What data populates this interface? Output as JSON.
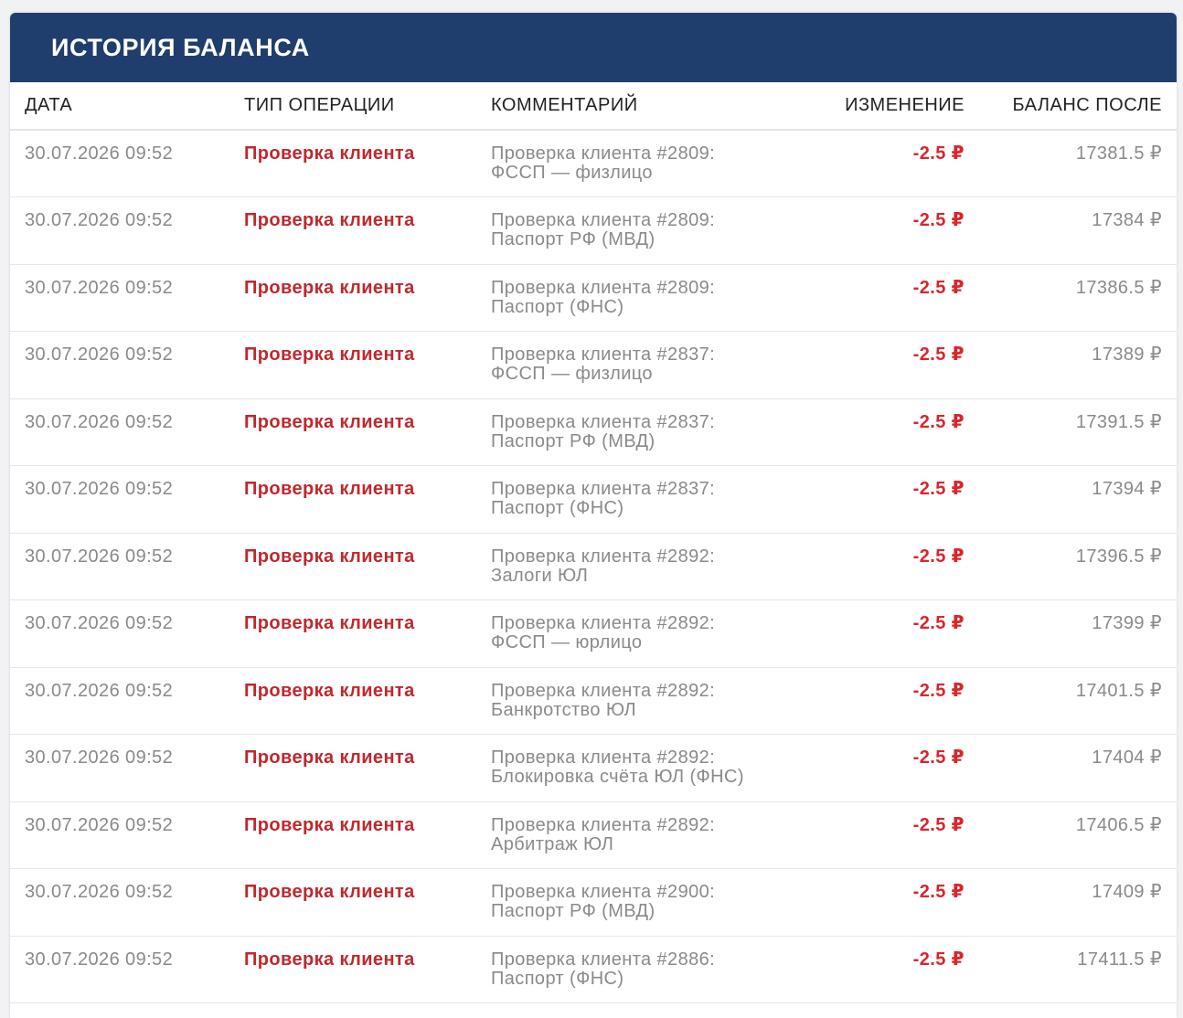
{
  "header": {
    "title": "ИСТОРИЯ БАЛАНСА"
  },
  "columns": {
    "date": "ДАТА",
    "type": "ТИП ОПЕРАЦИИ",
    "comment": "КОММЕНТАРИЙ",
    "change": "ИЗМЕНЕНИЕ",
    "balance": "БАЛАНС ПОСЛЕ"
  },
  "rows": [
    {
      "date": "30.07.2026 09:52",
      "type": "Проверка клиента",
      "comment1": "Проверка клиента #2809:",
      "comment2": "ФССП — физлицо",
      "change": "-2.5 ₽",
      "balance": "17381.5 ₽"
    },
    {
      "date": "30.07.2026 09:52",
      "type": "Проверка клиента",
      "comment1": "Проверка клиента #2809:",
      "comment2": "Паспорт РФ (МВД)",
      "change": "-2.5 ₽",
      "balance": "17384 ₽"
    },
    {
      "date": "30.07.2026 09:52",
      "type": "Проверка клиента",
      "comment1": "Проверка клиента #2809:",
      "comment2": "Паспорт (ФНС)",
      "change": "-2.5 ₽",
      "balance": "17386.5 ₽"
    },
    {
      "date": "30.07.2026 09:52",
      "type": "Проверка клиента",
      "comment1": "Проверка клиента #2837:",
      "comment2": "ФССП — физлицо",
      "change": "-2.5 ₽",
      "balance": "17389 ₽"
    },
    {
      "date": "30.07.2026 09:52",
      "type": "Проверка клиента",
      "comment1": "Проверка клиента #2837:",
      "comment2": "Паспорт РФ (МВД)",
      "change": "-2.5 ₽",
      "balance": "17391.5 ₽"
    },
    {
      "date": "30.07.2026 09:52",
      "type": "Проверка клиента",
      "comment1": "Проверка клиента #2837:",
      "comment2": "Паспорт (ФНС)",
      "change": "-2.5 ₽",
      "balance": "17394 ₽"
    },
    {
      "date": "30.07.2026 09:52",
      "type": "Проверка клиента",
      "comment1": "Проверка клиента #2892:",
      "comment2": "Залоги ЮЛ",
      "change": "-2.5 ₽",
      "balance": "17396.5 ₽"
    },
    {
      "date": "30.07.2026 09:52",
      "type": "Проверка клиента",
      "comment1": "Проверка клиента #2892:",
      "comment2": "ФССП — юрлицо",
      "change": "-2.5 ₽",
      "balance": "17399 ₽"
    },
    {
      "date": "30.07.2026 09:52",
      "type": "Проверка клиента",
      "comment1": "Проверка клиента #2892:",
      "comment2": "Банкротство ЮЛ",
      "change": "-2.5 ₽",
      "balance": "17401.5 ₽"
    },
    {
      "date": "30.07.2026 09:52",
      "type": "Проверка клиента",
      "comment1": "Проверка клиента #2892:",
      "comment2": "Блокировка счёта ЮЛ (ФНС)",
      "change": "-2.5 ₽",
      "balance": "17404 ₽"
    },
    {
      "date": "30.07.2026 09:52",
      "type": "Проверка клиента",
      "comment1": "Проверка клиента #2892:",
      "comment2": "Арбитраж ЮЛ",
      "change": "-2.5 ₽",
      "balance": "17406.5 ₽"
    },
    {
      "date": "30.07.2026 09:52",
      "type": "Проверка клиента",
      "comment1": "Проверка клиента #2900:",
      "comment2": "Паспорт РФ (МВД)",
      "change": "-2.5 ₽",
      "balance": "17409 ₽"
    },
    {
      "date": "30.07.2026 09:52",
      "type": "Проверка клиента",
      "comment1": "Проверка клиента #2886:",
      "comment2": "Паспорт (ФНС)",
      "change": "-2.5 ₽",
      "balance": "17411.5 ₽"
    }
  ],
  "colors": {
    "header_bg": "#1f3e6e",
    "type_red": "#c0282d",
    "change_red": "#d9262c",
    "muted_text": "#8a8a8a"
  }
}
